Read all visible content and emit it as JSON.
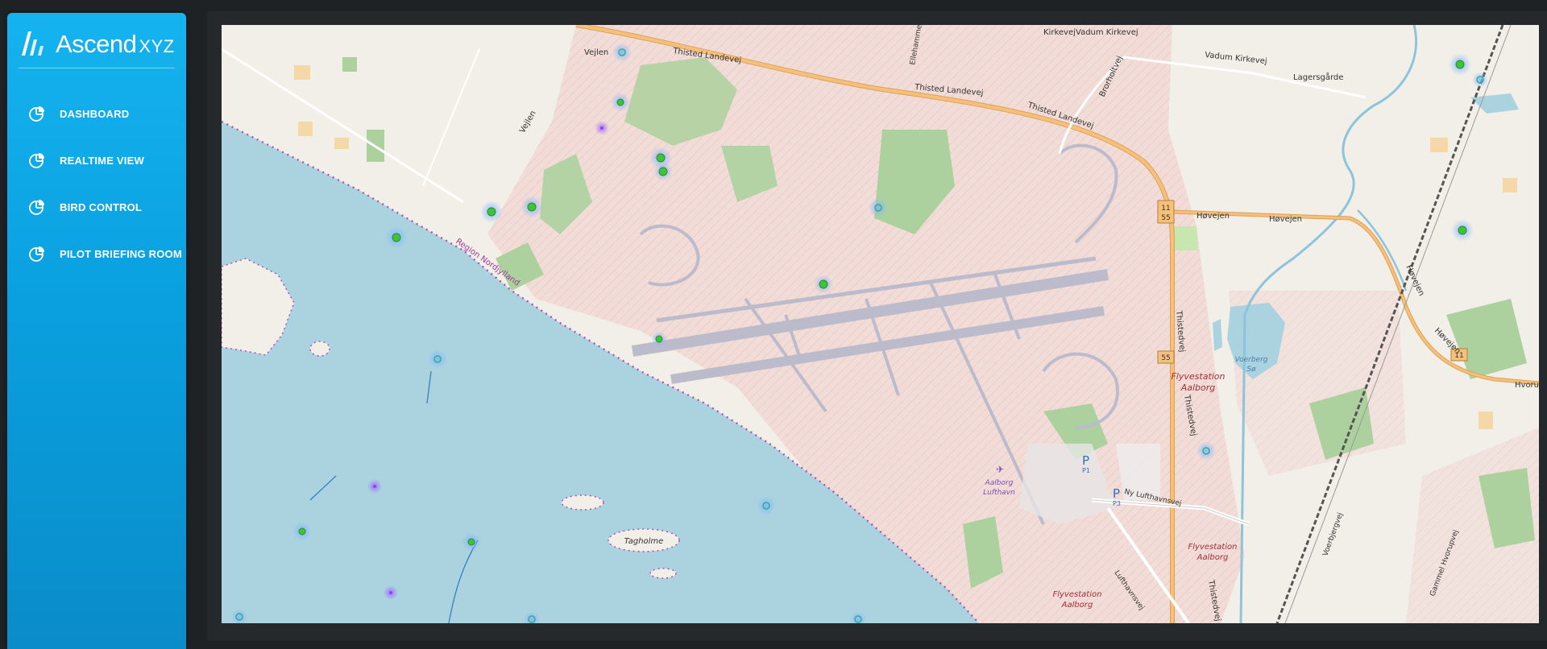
{
  "brand": {
    "name": "Ascend",
    "suffix": "XYZ"
  },
  "nav": {
    "items": [
      {
        "label": "DASHBOARD"
      },
      {
        "label": "REALTIME VIEW"
      },
      {
        "label": "BIRD CONTROL"
      },
      {
        "label": "PILOT BRIEFING ROOM"
      }
    ]
  },
  "map": {
    "labels": {
      "vejlen_top": "Vejlen",
      "vejlen_road": "Vejlen",
      "thisted_landevej_1": "Thisted Landevej",
      "thisted_landevej_2": "Thisted Landevej",
      "thisted_landevej_3": "Thisted Landevej",
      "kirkevej": "Kirkevej",
      "vadum_kirkevej_1": "Vadum Kirkevej",
      "vadum_kirkevej_2": "Vadum Kirkevej",
      "lagersgaarde": "Lagersgårde",
      "brorholtvej": "Brorholtvej",
      "region": "Region Nordjylland",
      "havejen_1": "Høvejen",
      "havejen_2": "Høvejen",
      "havejen_3": "Høvejen",
      "havejen_4": "Høvejen",
      "thistedvej_1": "Thistedvej",
      "thistedvej_2": "Thistedvej",
      "thistedvej_3": "Thistedvej",
      "flyvestation_1a": "Flyvestation",
      "flyvestation_1b": "Aalborg",
      "flyvestation_2a": "Flyvestation",
      "flyvestation_2b": "Aalborg",
      "flyvestation_3a": "Flyvestation",
      "flyvestation_3b": "Aalborg",
      "voerberg_1": "Voerberg",
      "voerberg_2": "Sø",
      "hvorup": "Hvorup",
      "lufthavn_1": "Aalborg",
      "lufthavn_2": "Lufthavn",
      "p1": "P",
      "p1_sub": "P1",
      "p3": "P",
      "p3_sub": "P3",
      "ny_lufthavnsvej": "Ny Lufthavnsvej",
      "lufthavnsvej": "Lufthavnsvej",
      "tagholme": "Tagholme",
      "shield_11_a": "11",
      "shield_55_a": "55",
      "shield_55_b": "55",
      "shield_11_b": "11",
      "voerbjergvej": "Voerbjergvej",
      "gammel_hvorupvej": "Gammel Hvorupvej",
      "ellehammer": "Ellehammervej"
    }
  },
  "colors": {
    "sidebar_top": "#15b3ef",
    "sidebar_bottom": "#0a8cc9",
    "water": "#aad3df",
    "land": "#f2efe9",
    "military": "#f2d9d5",
    "forest": "#add19e",
    "runway": "#bbbbcc",
    "road": "#f7c07a",
    "bird_marker": "#3cc43c"
  }
}
